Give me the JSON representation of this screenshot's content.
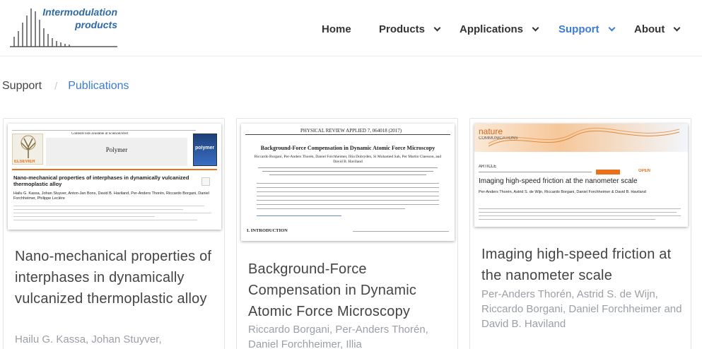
{
  "logo": {
    "line1": "Intermodulation",
    "line2": "products"
  },
  "nav": {
    "items": [
      {
        "label": "Home",
        "has_dropdown": false,
        "active": false
      },
      {
        "label": "Products",
        "has_dropdown": true,
        "active": false
      },
      {
        "label": "Applications",
        "has_dropdown": true,
        "active": false
      },
      {
        "label": "Support",
        "has_dropdown": true,
        "active": true
      },
      {
        "label": "About",
        "has_dropdown": true,
        "active": false
      }
    ]
  },
  "breadcrumb": {
    "root": "Support",
    "separator": "/",
    "current": "Publications"
  },
  "colors": {
    "accent": "#3a7bd5",
    "text": "#444444",
    "muted": "#9aa0a6",
    "logo": "#2f6aa6",
    "elsevier_orange": "#e9711c"
  },
  "cards": [
    {
      "title": "Nano-mechanical properties of interphases in dynamically vulcanized thermoplastic alloy",
      "authors": "Hailu G. Kassa, Johan Stuyver,",
      "thumb": {
        "journal_header": "Contents lists available at ScienceDirect",
        "journal_name": "Polymer",
        "publisher": "ELSEVIER",
        "cover_label": "polymer",
        "paper_title": "Nano-mechanical properties of interphases in dynamically vulcanized thermoplastic alloy",
        "paper_authors": "Hailu G. Kassa, Johan Stuyver, Anton-Jan Bons, David B. Haviland, Per-Anders Thorén, Riccardo Borgani, Daniel Forchheimer, Philippe Leclère"
      }
    },
    {
      "title": "Background-Force Compensation in Dynamic Atomic Force Microscopy",
      "authors": "Riccardo Borgani, Per-Anders Thorén, Daniel Forchheimer, Illia",
      "thumb": {
        "journal_header": "PHYSICAL REVIEW APPLIED 7, 064018 (2017)",
        "paper_title": "Background-Force Compensation in Dynamic Atomic Force Microscopy",
        "paper_authors": "Riccardo Borgani, Per-Anders Thorén, Daniel Forchheimer, Illia Dobryden, Si Mohamed Sah, Per Martin Claesson, and David B. Haviland",
        "section": "I. INTRODUCTION"
      }
    },
    {
      "title": "Imaging high-speed friction at the nanometer scale",
      "authors": "Per-Anders Thorén, Astrid S. de Wijn, Riccardo Borgani, Daniel Forchheimer and David B. Haviland",
      "thumb": {
        "journal_brand": "nature",
        "journal_sub": "COMMUNICATIONS",
        "article_label": "ARTICLE",
        "open_label": "OPEN",
        "paper_title": "Imaging high-speed friction at the nanometer scale",
        "paper_authors": "Per-Anders Thorén, Astrid S. de Wijn, Riccardo Borgani, Daniel Forchheimer & David B. Haviland"
      }
    }
  ]
}
